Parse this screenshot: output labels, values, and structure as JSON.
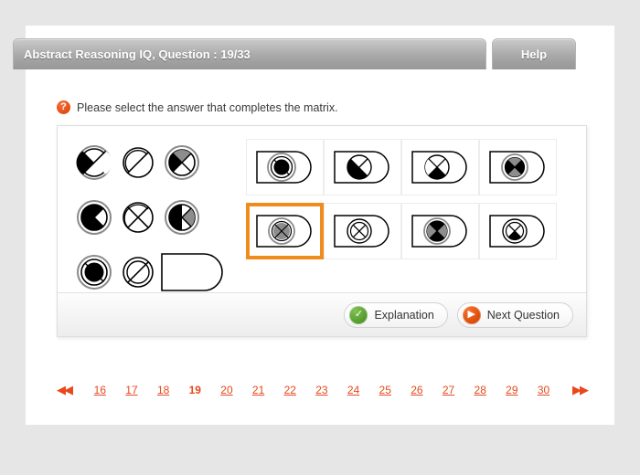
{
  "header": {
    "title": "Abstract Reasoning IQ, Question : 19/33",
    "help_label": "Help"
  },
  "instruction": {
    "icon": "question-mark-icon",
    "text": "Please select the answer that completes the matrix."
  },
  "matrix": {
    "rows": [
      [
        {
          "id": "m-r1c1",
          "shape": "circle-diagonal-black-upper-wedge"
        },
        {
          "id": "m-r1c2",
          "shape": "circle-diagonal-inner-arc"
        },
        {
          "id": "m-r1c3",
          "shape": "circle-cross-black-gray-wedges"
        }
      ],
      [
        {
          "id": "m-r2c1",
          "shape": "circle-cross-black-pacman"
        },
        {
          "id": "m-r2c2",
          "shape": "circle-cross-outline"
        },
        {
          "id": "m-r2c3",
          "shape": "circle-cross-black-gray-half"
        }
      ],
      [
        {
          "id": "m-r3c1",
          "shape": "circle-solid-black-disc"
        },
        {
          "id": "m-r3c2",
          "shape": "circle-diagonal-double-outline"
        },
        {
          "id": "m-r3c3",
          "shape": "missing-answer-placeholder"
        }
      ]
    ]
  },
  "options": {
    "selected_index": 4,
    "items": [
      {
        "id": "option-1",
        "shape": "capsule-circle-solid-black-disc",
        "selected": false
      },
      {
        "id": "option-2",
        "shape": "capsule-circle-diagonal-black-wedge",
        "selected": false
      },
      {
        "id": "option-3",
        "shape": "capsule-circle-cross-black-diagonal-band",
        "selected": false
      },
      {
        "id": "option-4",
        "shape": "capsule-circle-cross-black-gray-quadrants",
        "selected": false
      },
      {
        "id": "option-5",
        "shape": "capsule-circle-cross-gray-disc",
        "selected": true
      },
      {
        "id": "option-6",
        "shape": "capsule-circle-cross-outline",
        "selected": false
      },
      {
        "id": "option-7",
        "shape": "capsule-circle-cross-black-gray-bowtie",
        "selected": false
      },
      {
        "id": "option-8",
        "shape": "capsule-circle-cross-black-lower-wedge",
        "selected": false
      }
    ]
  },
  "footer": {
    "explanation_label": "Explanation",
    "explanation_icon": "check-circle-icon",
    "next_label": "Next Question",
    "next_icon": "play-circle-icon"
  },
  "pagination": {
    "prev_icon": "double-left-arrow-icon",
    "next_icon": "double-right-arrow-icon",
    "current": "19",
    "pages": [
      "16",
      "17",
      "18",
      "19",
      "20",
      "21",
      "22",
      "23",
      "24",
      "25",
      "26",
      "27",
      "28",
      "29",
      "30"
    ]
  },
  "colors": {
    "accent_orange": "#e8481c",
    "selection_orange": "#f08b1d",
    "header_gray": "#ababab",
    "page_background": "#e6e6e6",
    "shape_gray": "#808080"
  }
}
